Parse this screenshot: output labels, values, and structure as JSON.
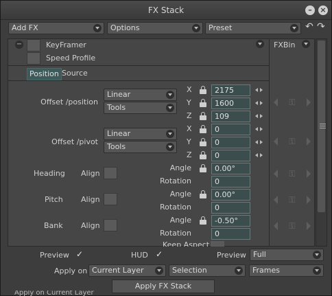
{
  "window": {
    "title": "FX Stack"
  },
  "toolbar": {
    "add_fx": "Add FX",
    "options": "Options",
    "preset": "Preset"
  },
  "fx_list": {
    "items": [
      {
        "label": "KeyFramer"
      },
      {
        "label": "Speed Profile"
      }
    ],
    "fxbin_label": "FXBin"
  },
  "tabs": [
    {
      "label": "Position",
      "active": true
    },
    {
      "label": "Source",
      "active": false
    }
  ],
  "offset_position": {
    "label": "Offset /position",
    "interp": "Linear",
    "tools": "Tools",
    "x_label": "X",
    "y_label": "Y",
    "z_label": "Z",
    "x": "2175",
    "y": "1600",
    "z": "109"
  },
  "offset_pivot": {
    "label": "Offset /pivot",
    "interp": "Linear",
    "tools": "Tools",
    "x_label": "X",
    "y_label": "Y",
    "z_label": "Z",
    "x": "0",
    "y": "0",
    "z": "0"
  },
  "rotations": [
    {
      "name": "Heading",
      "align": "Align",
      "angle_label": "Angle",
      "angle": "0.00°",
      "rotation_label": "Rotation",
      "rotation": "0"
    },
    {
      "name": "Pitch",
      "align": "Align",
      "angle_label": "Angle",
      "angle": "0.00°",
      "rotation_label": "Rotation",
      "rotation": "0"
    },
    {
      "name": "Bank",
      "align": "Align",
      "angle_label": "Angle",
      "angle": "-0.50°",
      "rotation_label": "Rotation",
      "rotation": "0"
    }
  ],
  "keep_aspect": "Keep Aspect",
  "bottom": {
    "preview_label": "Preview",
    "preview_checked": "✓",
    "hud_label": "HUD",
    "hud_checked": "✓",
    "preview2_label": "Preview",
    "preview2_value": "Full",
    "apply_on_label": "Apply on",
    "apply_on_value": "Current Layer",
    "selection_value": "Selection",
    "frames_value": "Frames",
    "apply_button": "Apply FX Stack"
  },
  "background_text": "Apply on  Current Layer"
}
